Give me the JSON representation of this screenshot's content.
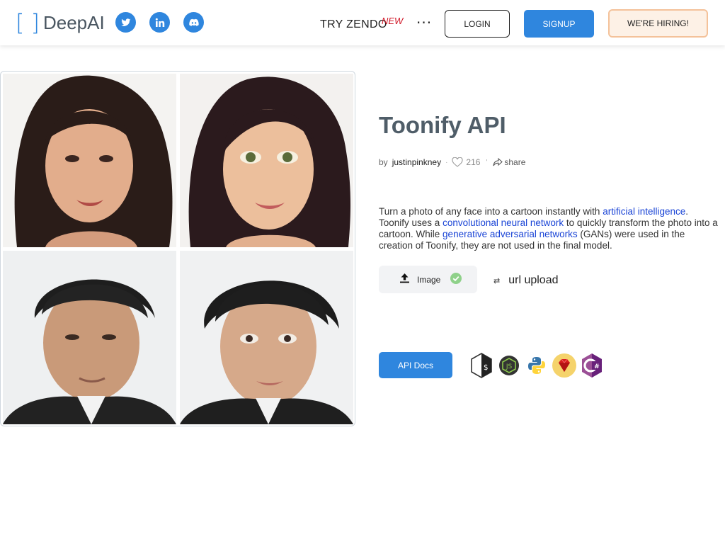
{
  "header": {
    "logo_text": "DeepAI",
    "try_zendo": "TRY ZENDO",
    "new_badge": "NEW",
    "more": "···",
    "login": "LOGIN",
    "signup": "SIGNUP",
    "hiring": "WE'RE HIRING!",
    "social_icons": [
      "twitter-icon",
      "linkedin-icon",
      "discord-icon"
    ]
  },
  "api": {
    "title": "Toonify API",
    "by": "by",
    "author": "justinpinkney",
    "likes": "216",
    "share": "share",
    "description": {
      "p1": "Turn a photo of any face into a cartoon instantly with ",
      "link1": "artificial intelligence",
      "p2": ". Toonify uses a ",
      "link2": "convolutional neural network",
      "p3": " to quickly transform the photo into a cartoon. While ",
      "link3": "generative adversarial networks",
      "p4": " (GANs) were used in the creation of Toonify, they are not used in the final model."
    },
    "upload_label": "Image",
    "url_upload": "url upload",
    "api_docs": "API Docs",
    "language_icons": [
      "shell-icon",
      "nodejs-icon",
      "python-icon",
      "ruby-icon",
      "csharp-icon"
    ]
  },
  "colors": {
    "brand_blue": "#2f86de",
    "title_gray": "#4f5d68",
    "link_blue": "#1a44d6",
    "new_red": "#d11a2a",
    "check_green": "#8fd18a"
  }
}
